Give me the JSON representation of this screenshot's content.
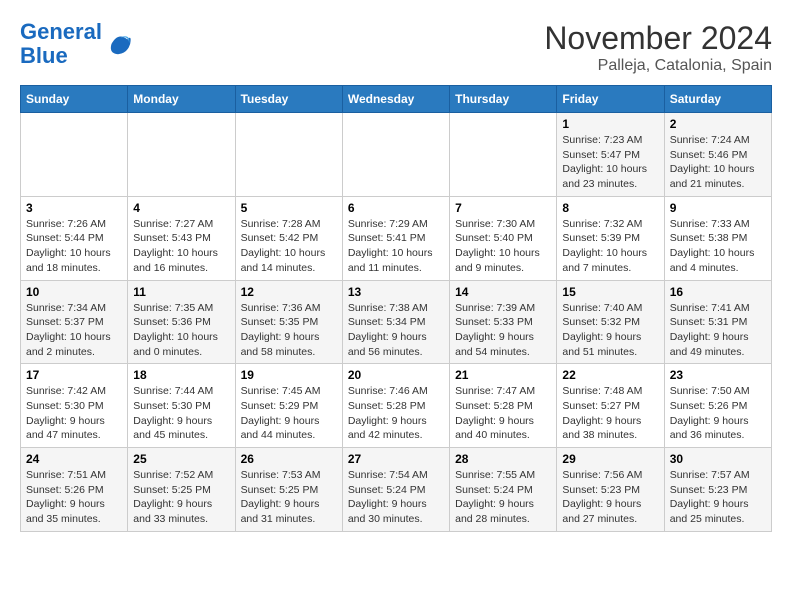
{
  "logo": {
    "line1": "General",
    "line2": "Blue"
  },
  "title": "November 2024",
  "location": "Palleja, Catalonia, Spain",
  "header": {
    "days": [
      "Sunday",
      "Monday",
      "Tuesday",
      "Wednesday",
      "Thursday",
      "Friday",
      "Saturday"
    ]
  },
  "weeks": [
    [
      {
        "day": "",
        "info": ""
      },
      {
        "day": "",
        "info": ""
      },
      {
        "day": "",
        "info": ""
      },
      {
        "day": "",
        "info": ""
      },
      {
        "day": "",
        "info": ""
      },
      {
        "day": "1",
        "info": "Sunrise: 7:23 AM\nSunset: 5:47 PM\nDaylight: 10 hours\nand 23 minutes."
      },
      {
        "day": "2",
        "info": "Sunrise: 7:24 AM\nSunset: 5:46 PM\nDaylight: 10 hours\nand 21 minutes."
      }
    ],
    [
      {
        "day": "3",
        "info": "Sunrise: 7:26 AM\nSunset: 5:44 PM\nDaylight: 10 hours\nand 18 minutes."
      },
      {
        "day": "4",
        "info": "Sunrise: 7:27 AM\nSunset: 5:43 PM\nDaylight: 10 hours\nand 16 minutes."
      },
      {
        "day": "5",
        "info": "Sunrise: 7:28 AM\nSunset: 5:42 PM\nDaylight: 10 hours\nand 14 minutes."
      },
      {
        "day": "6",
        "info": "Sunrise: 7:29 AM\nSunset: 5:41 PM\nDaylight: 10 hours\nand 11 minutes."
      },
      {
        "day": "7",
        "info": "Sunrise: 7:30 AM\nSunset: 5:40 PM\nDaylight: 10 hours\nand 9 minutes."
      },
      {
        "day": "8",
        "info": "Sunrise: 7:32 AM\nSunset: 5:39 PM\nDaylight: 10 hours\nand 7 minutes."
      },
      {
        "day": "9",
        "info": "Sunrise: 7:33 AM\nSunset: 5:38 PM\nDaylight: 10 hours\nand 4 minutes."
      }
    ],
    [
      {
        "day": "10",
        "info": "Sunrise: 7:34 AM\nSunset: 5:37 PM\nDaylight: 10 hours\nand 2 minutes."
      },
      {
        "day": "11",
        "info": "Sunrise: 7:35 AM\nSunset: 5:36 PM\nDaylight: 10 hours\nand 0 minutes."
      },
      {
        "day": "12",
        "info": "Sunrise: 7:36 AM\nSunset: 5:35 PM\nDaylight: 9 hours\nand 58 minutes."
      },
      {
        "day": "13",
        "info": "Sunrise: 7:38 AM\nSunset: 5:34 PM\nDaylight: 9 hours\nand 56 minutes."
      },
      {
        "day": "14",
        "info": "Sunrise: 7:39 AM\nSunset: 5:33 PM\nDaylight: 9 hours\nand 54 minutes."
      },
      {
        "day": "15",
        "info": "Sunrise: 7:40 AM\nSunset: 5:32 PM\nDaylight: 9 hours\nand 51 minutes."
      },
      {
        "day": "16",
        "info": "Sunrise: 7:41 AM\nSunset: 5:31 PM\nDaylight: 9 hours\nand 49 minutes."
      }
    ],
    [
      {
        "day": "17",
        "info": "Sunrise: 7:42 AM\nSunset: 5:30 PM\nDaylight: 9 hours\nand 47 minutes."
      },
      {
        "day": "18",
        "info": "Sunrise: 7:44 AM\nSunset: 5:30 PM\nDaylight: 9 hours\nand 45 minutes."
      },
      {
        "day": "19",
        "info": "Sunrise: 7:45 AM\nSunset: 5:29 PM\nDaylight: 9 hours\nand 44 minutes."
      },
      {
        "day": "20",
        "info": "Sunrise: 7:46 AM\nSunset: 5:28 PM\nDaylight: 9 hours\nand 42 minutes."
      },
      {
        "day": "21",
        "info": "Sunrise: 7:47 AM\nSunset: 5:28 PM\nDaylight: 9 hours\nand 40 minutes."
      },
      {
        "day": "22",
        "info": "Sunrise: 7:48 AM\nSunset: 5:27 PM\nDaylight: 9 hours\nand 38 minutes."
      },
      {
        "day": "23",
        "info": "Sunrise: 7:50 AM\nSunset: 5:26 PM\nDaylight: 9 hours\nand 36 minutes."
      }
    ],
    [
      {
        "day": "24",
        "info": "Sunrise: 7:51 AM\nSunset: 5:26 PM\nDaylight: 9 hours\nand 35 minutes."
      },
      {
        "day": "25",
        "info": "Sunrise: 7:52 AM\nSunset: 5:25 PM\nDaylight: 9 hours\nand 33 minutes."
      },
      {
        "day": "26",
        "info": "Sunrise: 7:53 AM\nSunset: 5:25 PM\nDaylight: 9 hours\nand 31 minutes."
      },
      {
        "day": "27",
        "info": "Sunrise: 7:54 AM\nSunset: 5:24 PM\nDaylight: 9 hours\nand 30 minutes."
      },
      {
        "day": "28",
        "info": "Sunrise: 7:55 AM\nSunset: 5:24 PM\nDaylight: 9 hours\nand 28 minutes."
      },
      {
        "day": "29",
        "info": "Sunrise: 7:56 AM\nSunset: 5:23 PM\nDaylight: 9 hours\nand 27 minutes."
      },
      {
        "day": "30",
        "info": "Sunrise: 7:57 AM\nSunset: 5:23 PM\nDaylight: 9 hours\nand 25 minutes."
      }
    ]
  ]
}
